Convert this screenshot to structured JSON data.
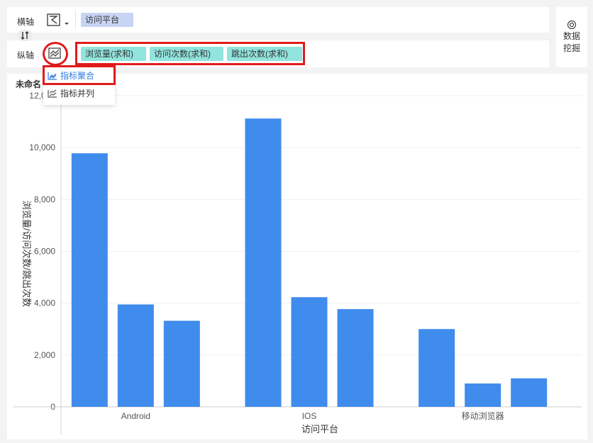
{
  "toolbar": {
    "x_axis_label": "横轴",
    "y_axis_label": "纵轴",
    "x_field": "访问平台",
    "y_fields": [
      "浏览量(求和)",
      "访问次数(求和)",
      "跳出次数(求和)"
    ],
    "data_mining_line1": "数据",
    "data_mining_line2": "挖掘"
  },
  "menu": {
    "items": [
      "指标聚合",
      "指标并列"
    ],
    "selected": "指标聚合"
  },
  "chart_title": "未命名",
  "colors": {
    "bar": "#3f8ced",
    "accent": "#2f7be0",
    "highlight_red": "#e11b1b",
    "dimension_pill": "#c7d4f3",
    "measure_pill": "#92e4de"
  },
  "chart_data": {
    "type": "bar",
    "categories": [
      "Android",
      "IOS",
      "移动浏览器"
    ],
    "series": [
      {
        "values": [
          9780,
          11120,
          3000
        ]
      },
      {
        "values": [
          3950,
          4230,
          900
        ]
      },
      {
        "values": [
          3320,
          3770,
          1100
        ]
      }
    ],
    "xlabel": "访问平台",
    "ylabel": "浏览量/访问次数/跳出次数",
    "ylim": [
      0,
      12000
    ],
    "yticks": [
      "0",
      "2,000",
      "4,000",
      "6,000",
      "8,000",
      "10,000",
      "12,000"
    ],
    "grid": true
  }
}
